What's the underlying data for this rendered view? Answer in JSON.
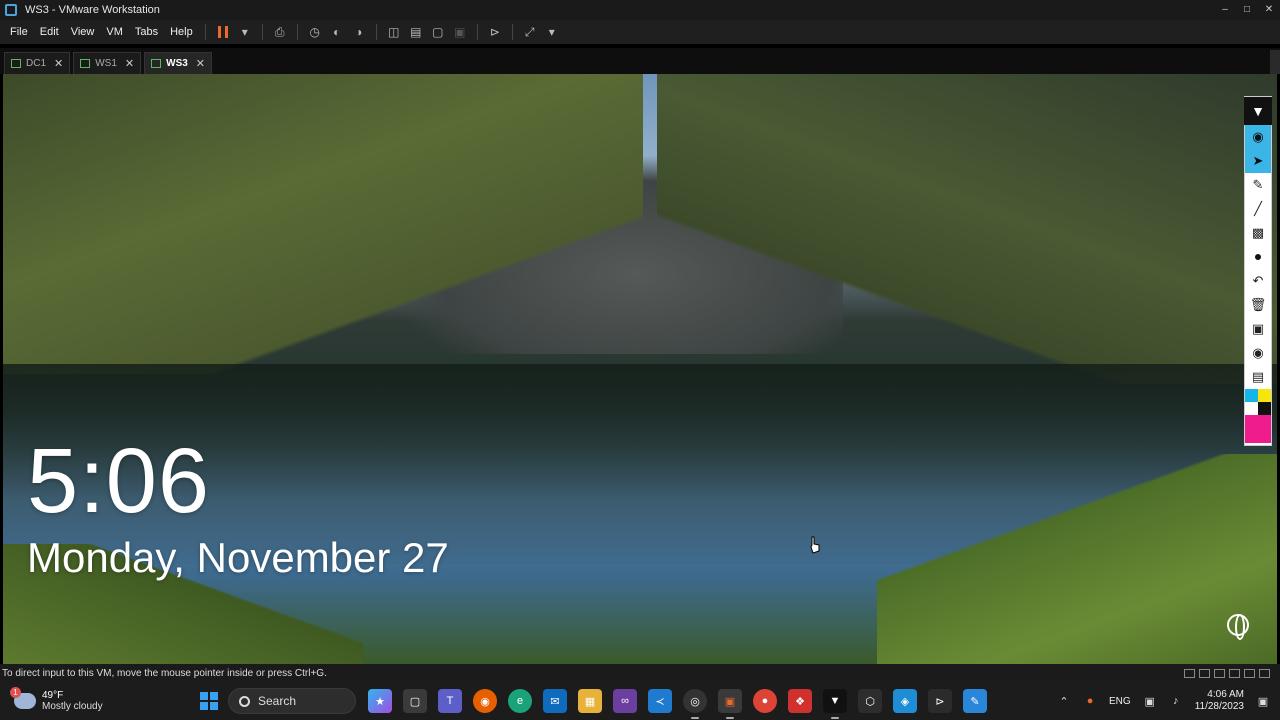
{
  "window": {
    "title": "WS3 - VMware Workstation"
  },
  "menu": {
    "items": [
      "File",
      "Edit",
      "View",
      "VM",
      "Tabs",
      "Help"
    ]
  },
  "tabs": [
    {
      "label": "DC1",
      "active": false
    },
    {
      "label": "WS1",
      "active": false
    },
    {
      "label": "WS3",
      "active": true
    }
  ],
  "lockscreen": {
    "time": "5:06",
    "date": "Monday, November 27"
  },
  "statusbar": {
    "hint": "To direct input to this VM, move the mouse pointer inside or press Ctrl+G."
  },
  "taskbar": {
    "weather": {
      "temp": "49°F",
      "condition": "Mostly cloudy",
      "badge": "1"
    },
    "search_label": "Search",
    "lang": "ENG",
    "time": "4:06 AM",
    "date": "11/28/2023"
  },
  "colors": {
    "accent": "#3bb4e6",
    "pause": "#e96a2a",
    "swatch_pink": "#ee1c8c",
    "swatch_cyan": "#16b4e8",
    "swatch_yellow": "#f6e60d"
  }
}
